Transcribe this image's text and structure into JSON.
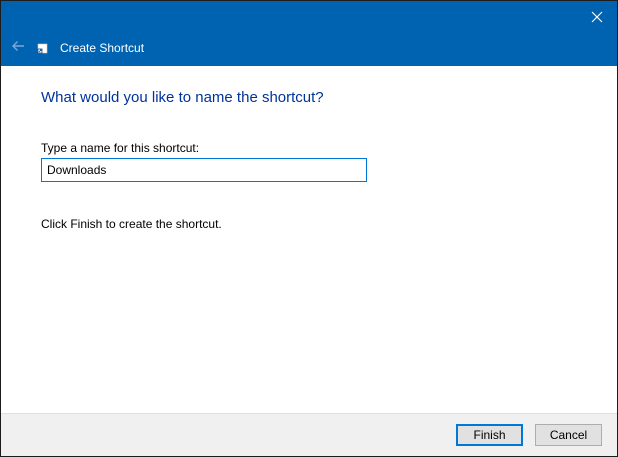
{
  "window": {
    "title": "Create Shortcut",
    "accent_color": "#0063b1"
  },
  "titlebar": {
    "close_icon": "close-icon",
    "back_icon": "back-arrow-icon",
    "app_icon": "shortcut-icon"
  },
  "main": {
    "heading": "What would you like to name the shortcut?",
    "field_label": "Type a name for this shortcut:",
    "name_value": "Downloads",
    "hint": "Click Finish to create the shortcut."
  },
  "footer": {
    "finish_label": "Finish",
    "cancel_label": "Cancel"
  }
}
